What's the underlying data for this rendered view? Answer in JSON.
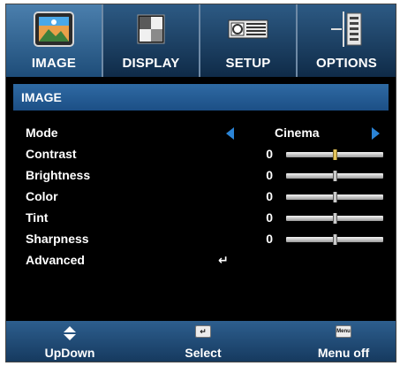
{
  "tabs": [
    {
      "label": "IMAGE",
      "icon": "image-icon",
      "active": true
    },
    {
      "label": "DISPLAY",
      "icon": "display-icon",
      "active": false
    },
    {
      "label": "SETUP",
      "icon": "setup-icon",
      "active": false
    },
    {
      "label": "OPTIONS",
      "icon": "options-icon",
      "active": false
    }
  ],
  "section": {
    "title": "IMAGE"
  },
  "menu": {
    "mode": {
      "label": "Mode",
      "value": "Cinema"
    },
    "contrast": {
      "label": "Contrast",
      "value": "0",
      "level": 0.5
    },
    "brightness": {
      "label": "Brightness",
      "value": "0",
      "level": 0.5
    },
    "color": {
      "label": "Color",
      "value": "0",
      "level": 0.5
    },
    "tint": {
      "label": "Tint",
      "value": "0",
      "level": 0.5
    },
    "sharpness": {
      "label": "Sharpness",
      "value": "0",
      "level": 0.5
    },
    "advanced": {
      "label": "Advanced",
      "icon": "enter-icon"
    }
  },
  "footer": {
    "updown": {
      "label": "UpDown",
      "icon": "updown-arrows-icon"
    },
    "select": {
      "label": "Select",
      "icon": "enter-key-icon"
    },
    "menuoff": {
      "label": "Menu off",
      "icon": "menu-key-icon",
      "key_text": "Menu"
    }
  },
  "colors": {
    "accent": "#2b84d6",
    "tab_bg": "#1b3f63",
    "section_bg": "#1c4f86",
    "selected_thumb": "#e2c35c"
  }
}
